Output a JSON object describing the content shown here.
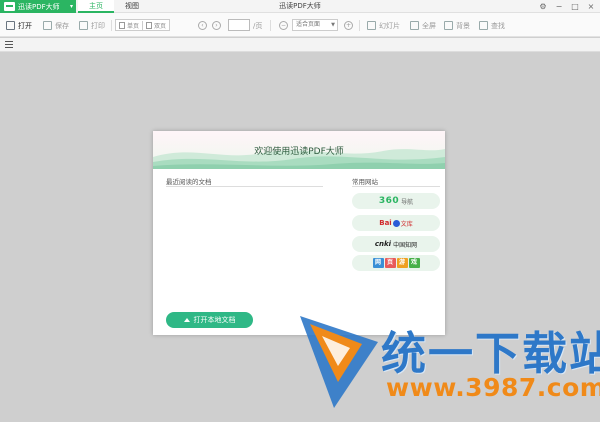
{
  "app": {
    "badge_name": "迅读PDF大师",
    "window_title": "迅读PDF大师",
    "tabs": [
      "主页",
      "视图"
    ]
  },
  "toolbar": {
    "open": "打开",
    "save": "保存",
    "print": "打印",
    "single_page": "单页",
    "double_page": "双页",
    "page_suffix": "/页",
    "fit_page": "适合页面",
    "slideshow": "幻灯片",
    "fullscreen": "全屏",
    "background": "背景",
    "find": "查找"
  },
  "dialog": {
    "title": "欢迎使用迅读PDF大师",
    "recent_title": "最近阅读的文档",
    "sites_title": "常用网站",
    "sites": {
      "s360_brand": "360",
      "s360_sub": "导航",
      "baidu_brand": "Bai",
      "baidu_sub": "文库",
      "cnki_brand": "cnki",
      "cnki_sub": "中国知网",
      "game_chars": [
        "网",
        "页",
        "游",
        "戏"
      ]
    },
    "open_local": "打开本地文档"
  },
  "watermark": {
    "title": "统一下载站",
    "url": "www.3987.com"
  },
  "colors": {
    "accent": "#2bb562",
    "button": "#2fb886",
    "watermark_blue": "#2e78c8",
    "watermark_orange": "#f08a19"
  }
}
